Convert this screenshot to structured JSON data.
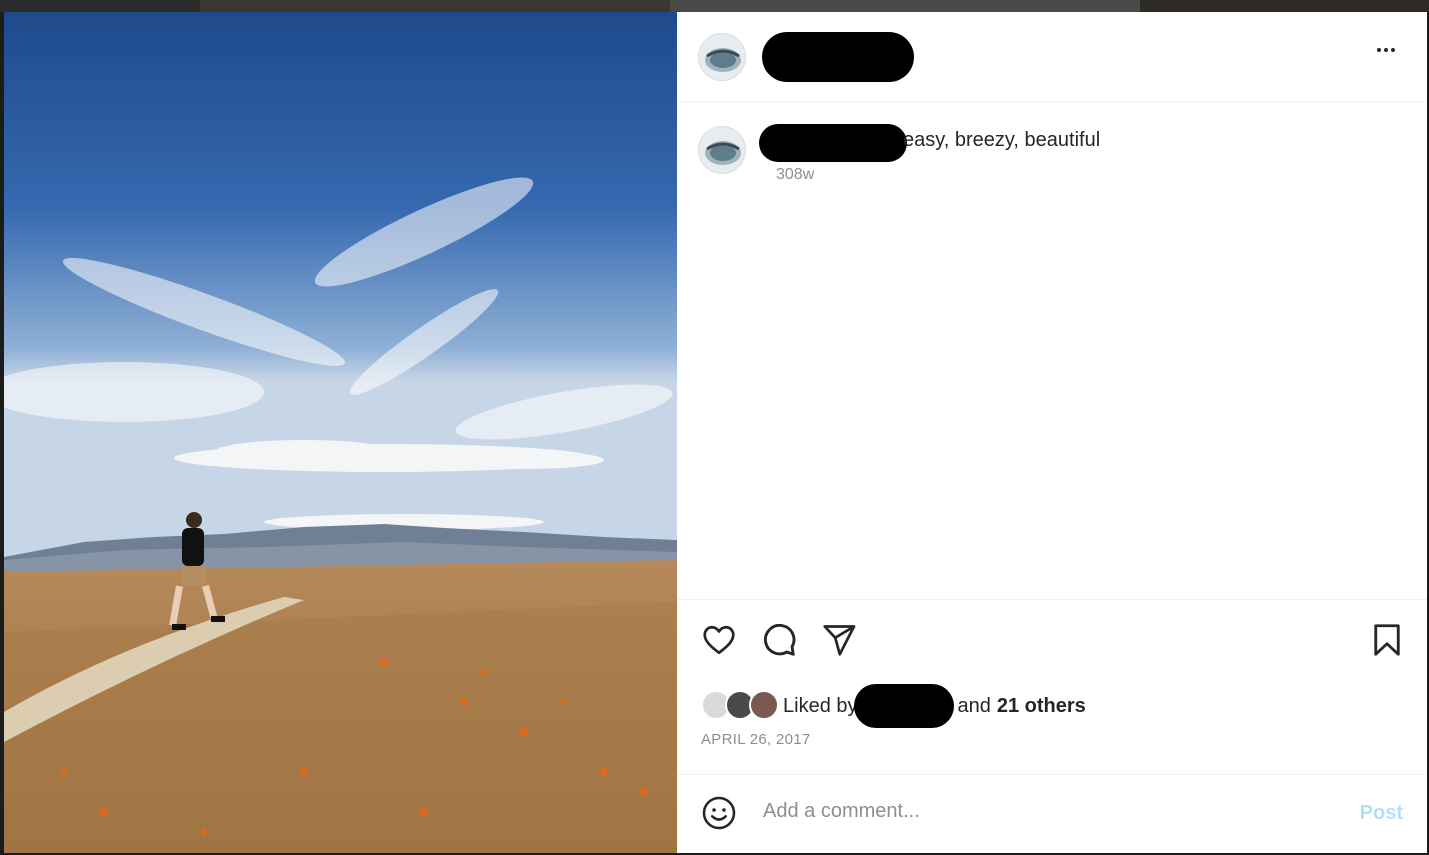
{
  "post": {
    "caption": "easy, breezy, beautiful",
    "time_ago": "308w",
    "likes_prefix": "Liked by",
    "likes_and": "and",
    "likes_others": "21 others",
    "date": "APRIL 26, 2017"
  },
  "comment": {
    "placeholder": "Add a comment...",
    "post_label": "Post"
  },
  "icons": {
    "more": "more-options-icon",
    "like": "heart-icon",
    "comment": "comment-icon",
    "share": "share-icon",
    "save": "bookmark-icon",
    "emoji": "emoji-icon"
  },
  "colors": {
    "text": "#262626",
    "muted": "#8e8e8e",
    "post_button_disabled": "#b2dffc",
    "divider": "#efefef"
  }
}
